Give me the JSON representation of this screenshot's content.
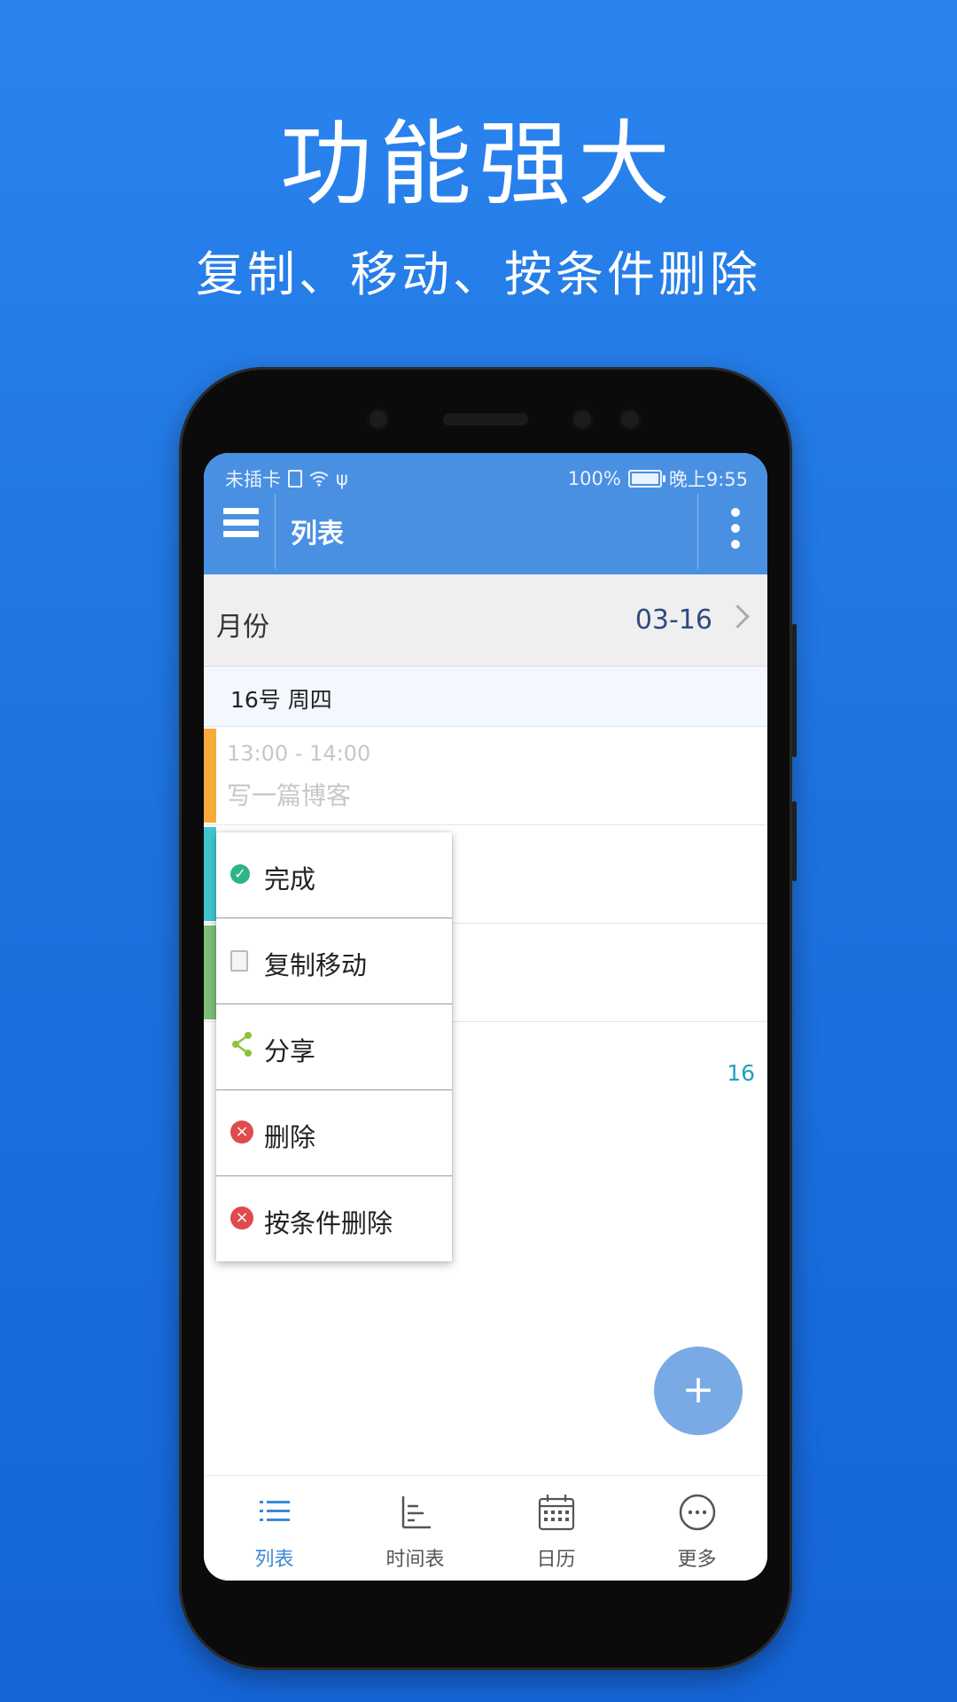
{
  "promo": {
    "title": "功能强大",
    "subtitle": "复制、移动、按条件删除"
  },
  "status_bar": {
    "carrier": "未插卡",
    "battery": "100%",
    "time": "晚上9:55"
  },
  "app_bar": {
    "title": "列表"
  },
  "month_row": {
    "label": "月份",
    "value": "03-16"
  },
  "day_header": {
    "label": "16号 周四"
  },
  "events": [
    {
      "time": "13:00 - 14:00",
      "title": "写一篇博客",
      "color": "#f7ab3b"
    },
    {
      "color": "#3fc6d1"
    },
    {
      "color": "#7ec07a"
    }
  ],
  "event_date_badge": "16",
  "context_menu": {
    "items": [
      {
        "label": "完成",
        "icon": "check-circle-icon"
      },
      {
        "label": "复制移动",
        "icon": "document-icon"
      },
      {
        "label": "分享",
        "icon": "share-icon"
      },
      {
        "label": "删除",
        "icon": "delete-x-icon"
      },
      {
        "label": "按条件删除",
        "icon": "delete-x-icon"
      }
    ]
  },
  "fab": {
    "label": "+"
  },
  "tabbar": {
    "tabs": [
      {
        "label": "列表",
        "icon": "list-icon",
        "active": true
      },
      {
        "label": "时间表",
        "icon": "timeline-icon",
        "active": false
      },
      {
        "label": "日历",
        "icon": "calendar-icon",
        "active": false
      },
      {
        "label": "更多",
        "icon": "more-icon",
        "active": false
      }
    ]
  },
  "colors": {
    "brand": "#4a90e2",
    "accent": "#3b8ad9",
    "danger": "#e04b4b",
    "success": "#2fb38a"
  }
}
